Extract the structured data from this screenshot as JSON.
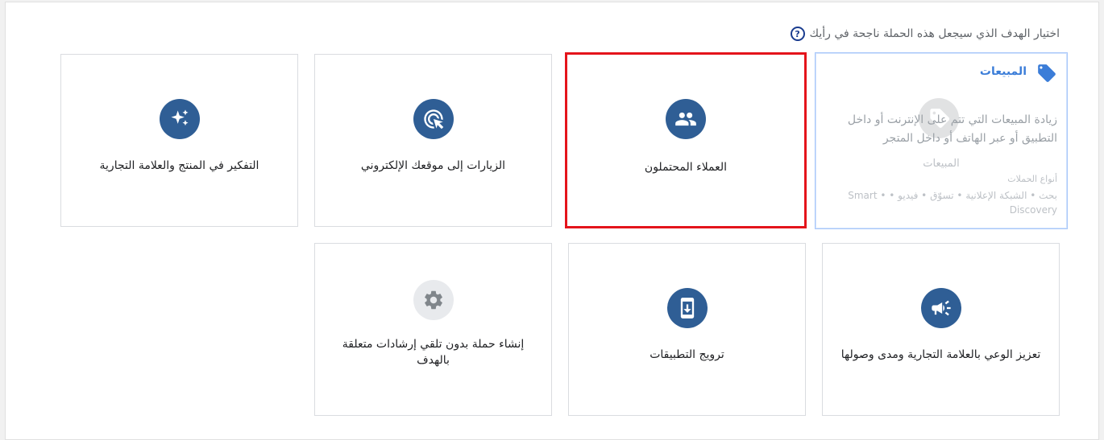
{
  "heading": "اختيار الهدف الذي سيجعل هذه الحملة ناجحة في رأيك",
  "help_icon": "?",
  "sales": {
    "title": "المبيعات",
    "description": "زيادة المبيعات التي تتم على الإنترنت أو داخل التطبيق أو عبر الهاتف أو داخل المتجر",
    "subtitle": "المبيعات",
    "campaign_types_label": "أنواع الحملات",
    "campaign_types": "بحث • الشبكة الإعلانية • تسوّق • فيديو • • Smart Discovery",
    "icon": "tag-icon"
  },
  "leads": {
    "label": "العملاء المحتملون",
    "icon": "people-icon"
  },
  "traffic": {
    "label": "الزيارات إلى موقعك الإلكتروني",
    "icon": "cursor-click-icon"
  },
  "consideration": {
    "label": "التفكير في المنتج والعلامة التجارية",
    "icon": "sparkle-icon"
  },
  "awareness": {
    "label": "تعزيز الوعي بالعلامة التجارية ومدى وصولها",
    "icon": "megaphone-icon"
  },
  "app_promotion": {
    "label": "ترويج التطبيقات",
    "icon": "phone-download-icon"
  },
  "no_goal": {
    "label": "إنشاء حملة بدون تلقي إرشادات متعلقة بالهدف",
    "icon": "gear-icon"
  },
  "colors": {
    "accent": "#2f5e95",
    "selected_border": "#e4141b",
    "sales_title": "#3b7dd8"
  }
}
